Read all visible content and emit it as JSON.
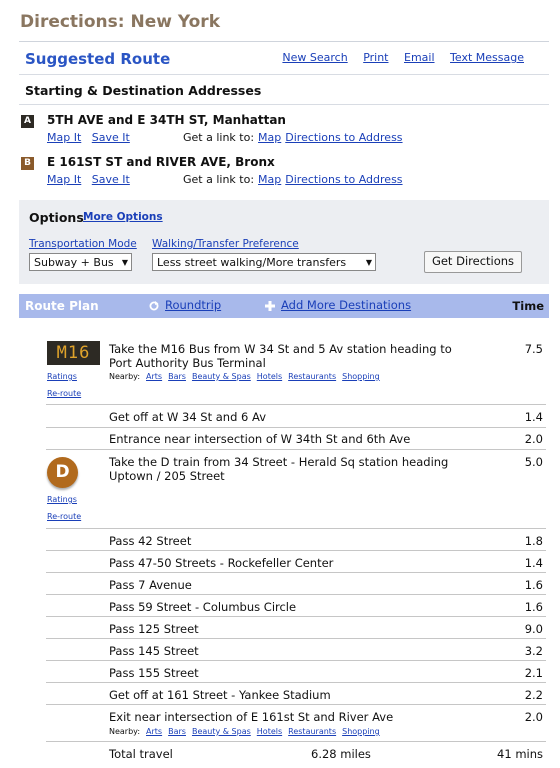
{
  "page": {
    "title": "Directions: New York"
  },
  "header": {
    "suggested": "Suggested Route",
    "links": [
      "New Search",
      "Print",
      "Email",
      "Text Message"
    ]
  },
  "addresses": {
    "heading": "Starting & Destination Addresses",
    "start": {
      "badge": "A",
      "text": "5TH AVE and E 34TH ST, Manhattan",
      "map": "Map It",
      "save": "Save It",
      "getlink": "Get a link to:",
      "l1": "Map",
      "l2": "Directions to Address"
    },
    "end": {
      "badge": "B",
      "text": "E 161ST ST and RIVER AVE, Bronx",
      "map": "Map It",
      "save": "Save It",
      "getlink": "Get a link to:",
      "l1": "Map",
      "l2": "Directions to Address"
    }
  },
  "options": {
    "title": "Options",
    "more": "More Options",
    "mode_label": "Transportation Mode",
    "mode_value": "Subway + Bus",
    "walk_label": "Walking/Transfer Preference",
    "walk_value": "Less street walking/More transfers",
    "button": "Get Directions"
  },
  "route": {
    "title": "Route Plan",
    "roundtrip": "Roundtrip",
    "add": "Add More Destinations",
    "time_header": "Time",
    "bus_label": "M16",
    "train_label": "D",
    "ratings": "Ratings",
    "reroute": "Re-route",
    "nearby_label": "Nearby:",
    "nearby": [
      "Arts",
      "Bars",
      "Beauty & Spas",
      "Hotels",
      "Restaurants",
      "Shopping"
    ],
    "steps": [
      {
        "text": "Take the M16 Bus from W 34 St and 5 Av station heading to Port Authority Bus Terminal",
        "time": "7.5"
      },
      {
        "text": "Get off at W 34 St and 6 Av",
        "time": "1.4"
      },
      {
        "text": "Entrance near intersection of W 34th St and 6th Ave",
        "time": "2.0"
      },
      {
        "text": "Take the D train from 34 Street - Herald Sq station heading Uptown / 205 Street",
        "time": "5.0"
      },
      {
        "text": "Pass 42 Street",
        "time": "1.8"
      },
      {
        "text": "Pass 47-50 Streets - Rockefeller Center",
        "time": "1.4"
      },
      {
        "text": "Pass 7 Avenue",
        "time": "1.6"
      },
      {
        "text": "Pass 59 Street - Columbus Circle",
        "time": "1.6"
      },
      {
        "text": "Pass 125 Street",
        "time": "9.0"
      },
      {
        "text": "Pass 145 Street",
        "time": "3.2"
      },
      {
        "text": "Pass 155 Street",
        "time": "2.1"
      },
      {
        "text": "Get off at 161 Street - Yankee Stadium",
        "time": "2.2"
      },
      {
        "text": "Exit near intersection of E 161st St and River Ave",
        "time": "2.0"
      }
    ],
    "total_label": "Total travel",
    "total_distance": "6.28 miles",
    "total_time": "41 mins"
  },
  "colors": {
    "title": "#8a7660",
    "accent": "#2a55c4",
    "bar": "#a8b9eb",
    "badge_a": "#2d2a24",
    "badge_b": "#8a5a2b",
    "d_train": "#b16a1d"
  }
}
